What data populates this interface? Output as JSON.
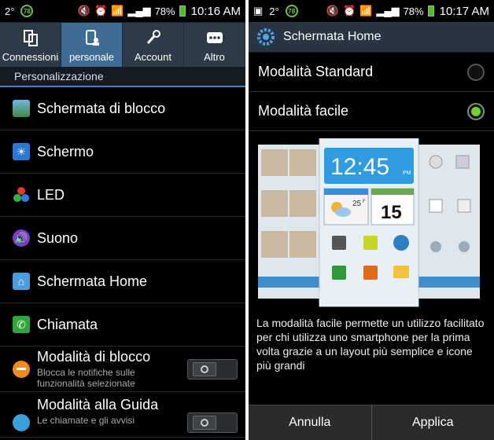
{
  "left": {
    "status": {
      "temp": "2°",
      "badge": "78",
      "battery": "78%",
      "time": "10:16 AM"
    },
    "tabs": [
      {
        "label": "Connessioni",
        "icon": "connections-icon"
      },
      {
        "label": "personale",
        "icon": "personal-icon"
      },
      {
        "label": "Account",
        "icon": "key-icon"
      },
      {
        "label": "Altro",
        "icon": "more-icon"
      }
    ],
    "section": "Personalizzazione",
    "items": [
      {
        "label": "Schermata di blocco",
        "icon": "lockscreen-icon"
      },
      {
        "label": "Schermo",
        "icon": "display-icon"
      },
      {
        "label": "LED",
        "icon": "led-icon"
      },
      {
        "label": "Suono",
        "icon": "sound-icon"
      },
      {
        "label": "Schermata Home",
        "icon": "home-icon"
      },
      {
        "label": "Chiamata",
        "icon": "call-icon"
      }
    ],
    "toggle_items": [
      {
        "label": "Modalità di blocco",
        "sub1": "Blocca le notifiche sulle",
        "sub2": "funzionalità selezionate"
      },
      {
        "label": "Modalità alla Guida",
        "sub1": "Le chiamate e gli avvisi"
      }
    ]
  },
  "right": {
    "status": {
      "temp": "2°",
      "badge": "78",
      "battery": "78%",
      "time": "10:17 AM"
    },
    "title": "Schermata Home",
    "options": [
      {
        "label": "Modalità Standard",
        "selected": false
      },
      {
        "label": "Modalità facile",
        "selected": true
      }
    ],
    "preview": {
      "time": "12:45",
      "time_suffix": "PM",
      "temp": "25",
      "temp_unit": "F",
      "date": "15"
    },
    "description": "La modalità facile permette un utilizzo facilitato per chi utilizza uno smartphone per la prima volta grazie a un layout più semplice e icone più grandi",
    "buttons": {
      "cancel": "Annulla",
      "apply": "Applica"
    }
  }
}
